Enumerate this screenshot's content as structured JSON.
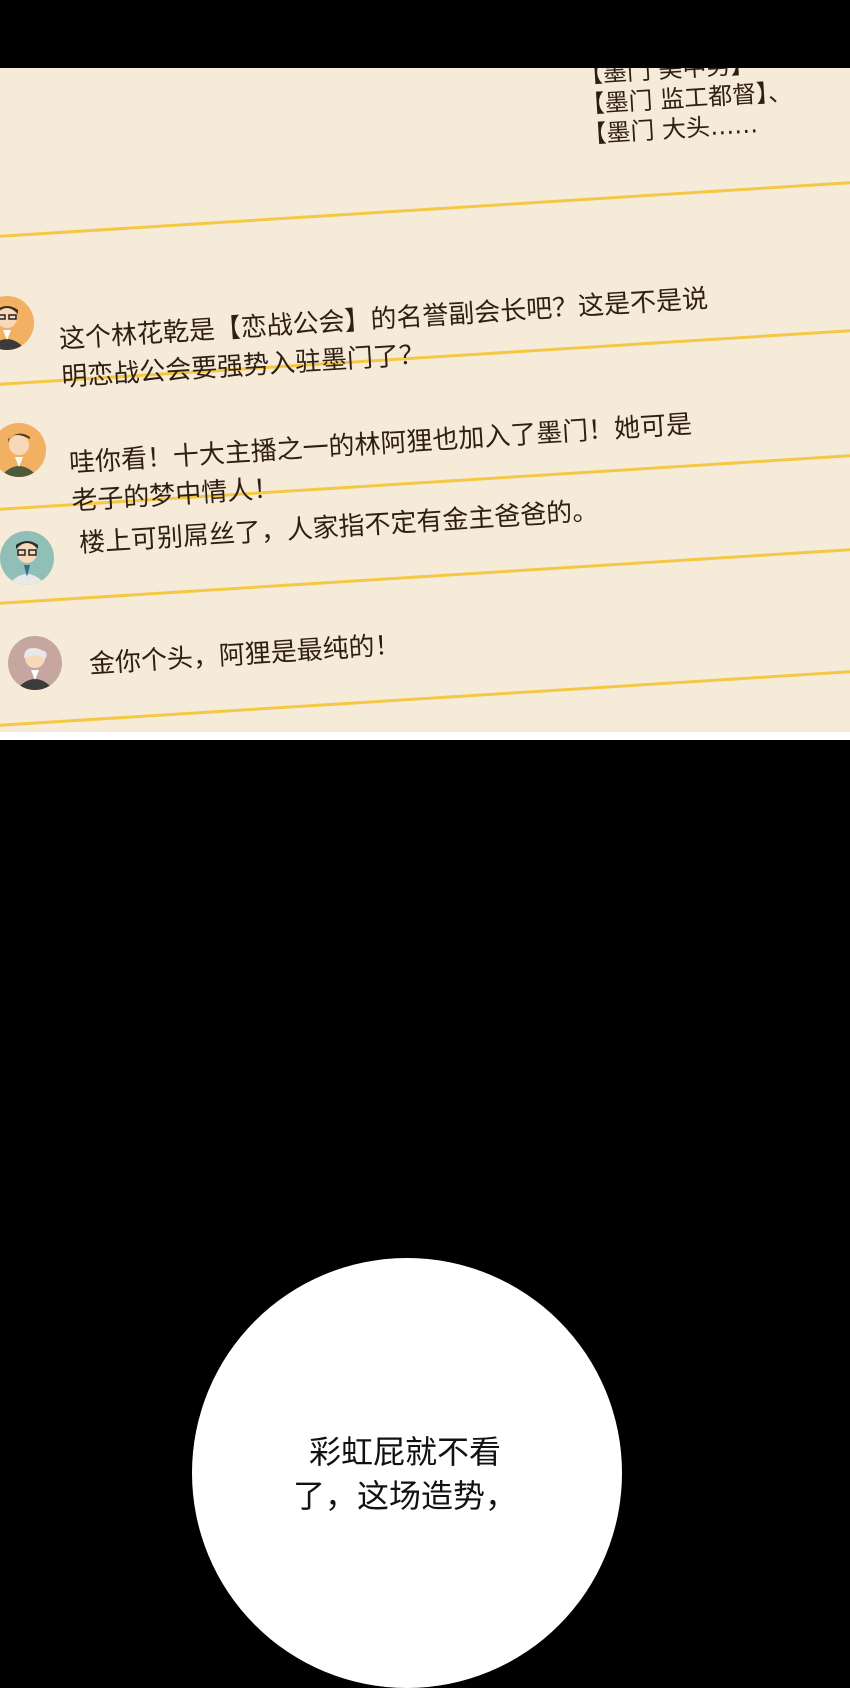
{
  "header_lines": [
    "【墨门 美中男】",
    "【墨门 监工都督】、",
    "【墨门 大头……"
  ],
  "comments": [
    {
      "avatar": "avatar-man-glasses-orange",
      "lines": [
        "这个林花乾是【恋战公会】的名誉副会长吧？这是不是说",
        "明恋战公会要强势入驻墨门了？"
      ]
    },
    {
      "avatar": "avatar-man-orange",
      "lines": [
        "哇你看！十大主播之一的林阿狸也加入了墨门！她可是",
        "老子的梦中情人！"
      ]
    },
    {
      "avatar": "avatar-man-glasses-teal",
      "lines": [
        "楼上可别屌丝了，人家指不定有金主爸爸的。"
      ]
    },
    {
      "avatar": "avatar-old-man-mauve",
      "lines": [
        "金你个头，阿狸是最纯的！"
      ]
    }
  ],
  "speech_bubble": {
    "lines": [
      "彩虹屁就不看",
      "了，这场造势，"
    ]
  },
  "colors": {
    "paper": "#f6ead8",
    "rule": "#f5c843",
    "text": "#2e1e14",
    "background": "#000000"
  }
}
